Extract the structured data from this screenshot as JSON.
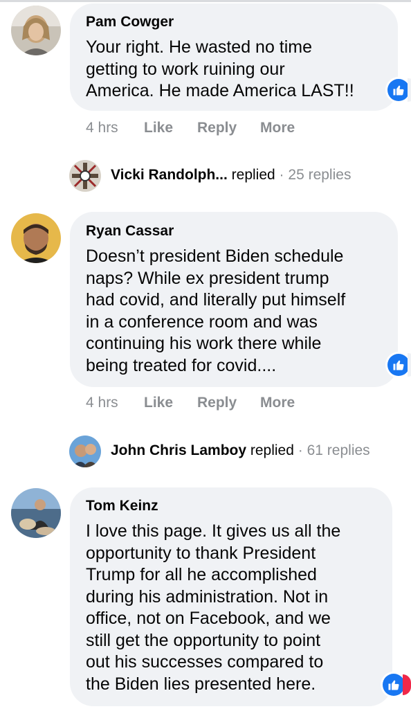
{
  "comments": [
    {
      "author": "Pam Cowger",
      "lines": [
        "Your right. He wasted no time",
        "getting to work ruining our",
        "America. He made America LAST!!"
      ],
      "time": "4 hrs",
      "like_label": "Like",
      "reply_label": "Reply",
      "more_label": "More",
      "reaction_icon": "thumbs-up-reaction-icon"
    },
    {
      "author": "Ryan Cassar",
      "lines": [
        "Doesn’t president Biden schedule",
        "naps? While ex president trump",
        "had covid, and literally put himself",
        "in a conference room and was",
        "continuing his work there while",
        "being treated for covid...."
      ],
      "time": "4 hrs",
      "like_label": "Like",
      "reply_label": "Reply",
      "more_label": "More",
      "reaction_icon": "thumbs-up-reaction-icon"
    },
    {
      "author": "Tom Keinz",
      "lines": [
        "I love this page. It gives us all the",
        "opportunity to thank President",
        "Trump for all he accomplished",
        "during his administration. Not in",
        "office, not on Facebook, and we",
        "still get the opportunity to point",
        "out his successes compared to",
        "the Biden lies presented here."
      ],
      "reaction_icon": "thumbs-up-reaction-icon"
    }
  ],
  "replies": [
    {
      "name": "Vicki Randolph...",
      "verb": "replied",
      "dot": "·",
      "count": "25 replies"
    },
    {
      "name": "John Chris Lamboy",
      "verb": "replied",
      "dot": "·",
      "count": "61 replies"
    }
  ],
  "colors": {
    "bubble": "#f0f2f5",
    "meta_gray": "#8a8d91",
    "like_blue": "#1877f2",
    "haha_red": "#f02849"
  }
}
